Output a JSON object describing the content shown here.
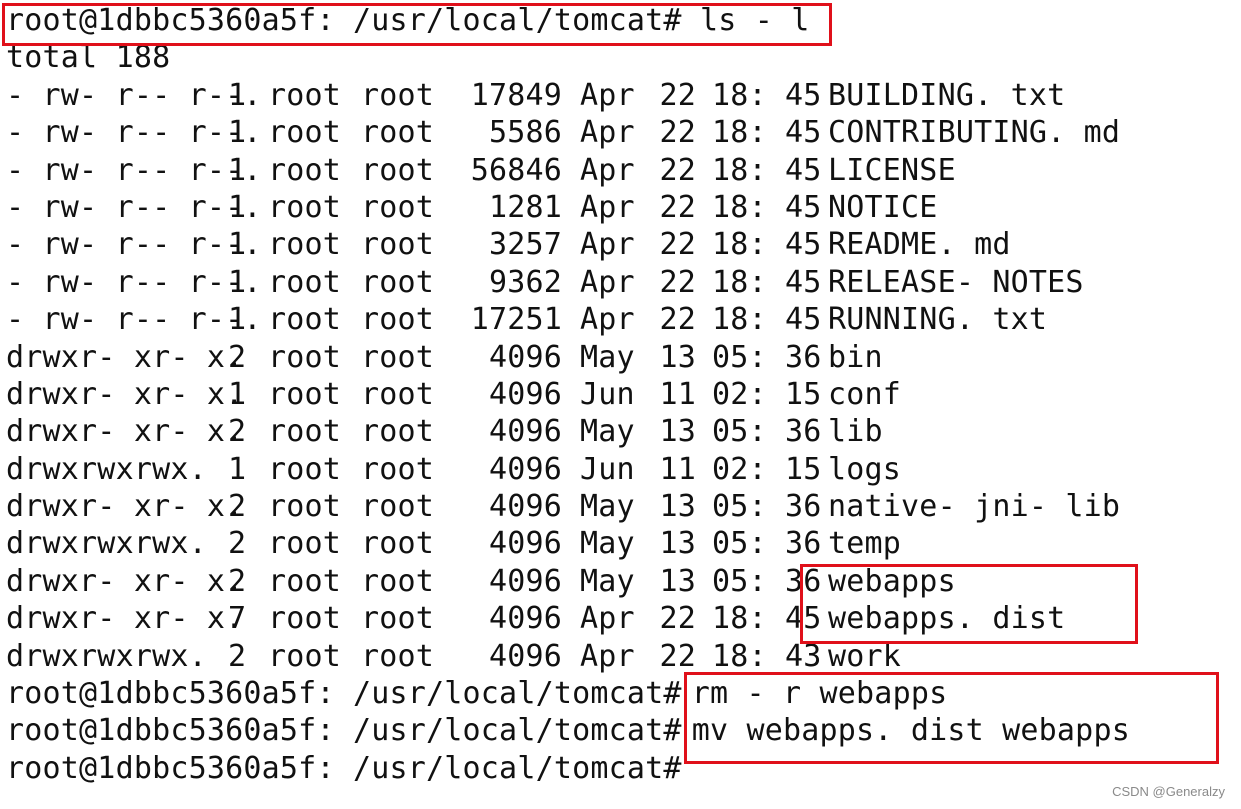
{
  "terminal": {
    "prompt": "root@1dbbc5360a5f: /usr/local/tomcat#",
    "first_command": "ls - l",
    "total_line": "total 188",
    "entries": [
      {
        "perm": "- rw- r-- r--.",
        "links": "1",
        "owner": "root",
        "group": "root",
        "size": "17849",
        "month": "Apr",
        "day": "22",
        "time": "18: 45",
        "name": "BUILDING. txt"
      },
      {
        "perm": "- rw- r-- r--.",
        "links": "1",
        "owner": "root",
        "group": "root",
        "size": "5586",
        "month": "Apr",
        "day": "22",
        "time": "18: 45",
        "name": "CONTRIBUTING. md"
      },
      {
        "perm": "- rw- r-- r--.",
        "links": "1",
        "owner": "root",
        "group": "root",
        "size": "56846",
        "month": "Apr",
        "day": "22",
        "time": "18: 45",
        "name": "LICENSE"
      },
      {
        "perm": "- rw- r-- r--.",
        "links": "1",
        "owner": "root",
        "group": "root",
        "size": "1281",
        "month": "Apr",
        "day": "22",
        "time": "18: 45",
        "name": "NOTICE"
      },
      {
        "perm": "- rw- r-- r--.",
        "links": "1",
        "owner": "root",
        "group": "root",
        "size": "3257",
        "month": "Apr",
        "day": "22",
        "time": "18: 45",
        "name": "README. md"
      },
      {
        "perm": "- rw- r-- r--.",
        "links": "1",
        "owner": "root",
        "group": "root",
        "size": "9362",
        "month": "Apr",
        "day": "22",
        "time": "18: 45",
        "name": "RELEASE- NOTES"
      },
      {
        "perm": "- rw- r-- r--.",
        "links": "1",
        "owner": "root",
        "group": "root",
        "size": "17251",
        "month": "Apr",
        "day": "22",
        "time": "18: 45",
        "name": "RUNNING. txt"
      },
      {
        "perm": "drwxr- xr- x.",
        "links": "2",
        "owner": "root",
        "group": "root",
        "size": "4096",
        "month": "May",
        "day": "13",
        "time": "05: 36",
        "name": "bin"
      },
      {
        "perm": "drwxr- xr- x.",
        "links": "1",
        "owner": "root",
        "group": "root",
        "size": "4096",
        "month": "Jun",
        "day": "11",
        "time": "02: 15",
        "name": "conf"
      },
      {
        "perm": "drwxr- xr- x.",
        "links": "2",
        "owner": "root",
        "group": "root",
        "size": "4096",
        "month": "May",
        "day": "13",
        "time": "05: 36",
        "name": "lib"
      },
      {
        "perm": "drwxrwxrwx.",
        "links": "1",
        "owner": "root",
        "group": "root",
        "size": "4096",
        "month": "Jun",
        "day": "11",
        "time": "02: 15",
        "name": "logs"
      },
      {
        "perm": "drwxr- xr- x.",
        "links": "2",
        "owner": "root",
        "group": "root",
        "size": "4096",
        "month": "May",
        "day": "13",
        "time": "05: 36",
        "name": "native- jni- lib"
      },
      {
        "perm": "drwxrwxrwx.",
        "links": "2",
        "owner": "root",
        "group": "root",
        "size": "4096",
        "month": "May",
        "day": "13",
        "time": "05: 36",
        "name": "temp"
      },
      {
        "perm": "drwxr- xr- x.",
        "links": "2",
        "owner": "root",
        "group": "root",
        "size": "4096",
        "month": "May",
        "day": "13",
        "time": "05: 36",
        "name": "webapps"
      },
      {
        "perm": "drwxr- xr- x.",
        "links": "7",
        "owner": "root",
        "group": "root",
        "size": "4096",
        "month": "Apr",
        "day": "22",
        "time": "18: 45",
        "name": "webapps. dist"
      },
      {
        "perm": "drwxrwxrwx.",
        "links": "2",
        "owner": "root",
        "group": "root",
        "size": "4096",
        "month": "Apr",
        "day": "22",
        "time": "18: 43",
        "name": "work"
      }
    ],
    "commands": [
      {
        "command": "rm - r webapps"
      },
      {
        "command": "mv webapps. dist webapps"
      },
      {
        "command": ""
      }
    ],
    "highlight_color": "#e0101a"
  },
  "watermark": "CSDN @Generalzy"
}
